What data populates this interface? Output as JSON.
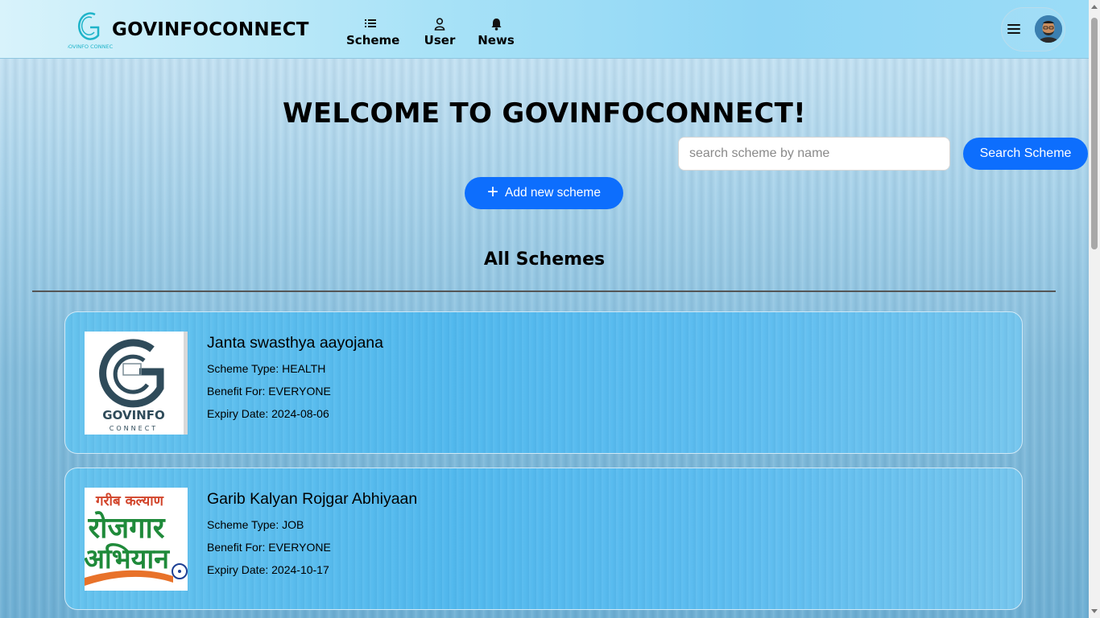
{
  "app": {
    "brand_name": "GOVINFOCONNECT",
    "logo_text": "GOVINFO CONNECT"
  },
  "nav": {
    "items": [
      {
        "label": "Scheme",
        "icon": "list-icon"
      },
      {
        "label": "User",
        "icon": "user-icon"
      },
      {
        "label": "News",
        "icon": "bell-icon"
      }
    ],
    "menu_icon": "hamburger-icon",
    "avatar": "user-avatar"
  },
  "main": {
    "welcome": "WELCOME TO GOVINFOCONNECT!",
    "search": {
      "placeholder": "search scheme by name",
      "value": "",
      "button_label": "Search Scheme"
    },
    "add_button_label": "Add new scheme",
    "section_title": "All Schemes"
  },
  "schemes": [
    {
      "name": "Janta swasthya aayojana",
      "type_line": "Scheme Type: HEALTH",
      "benefit_line": "Benefit For: EVERYONE",
      "expiry_line": "Expiry Date: 2024-08-06",
      "image_text_main": "GOVINFO",
      "image_text_sub": "CONNECT"
    },
    {
      "name": "Garib Kalyan Rojgar Abhiyaan",
      "type_line": "Scheme Type: JOB",
      "benefit_line": "Benefit For: EVERYONE",
      "expiry_line": "Expiry Date: 2024-10-17",
      "image_text_top": "गरीब कल्याण",
      "image_text_mid": "रोजगार",
      "image_text_bot": "अभियान"
    }
  ],
  "colors": {
    "primary": "#0d6efd",
    "card_bg": "#52b9ee",
    "header_bg": "#a8e2f7"
  }
}
